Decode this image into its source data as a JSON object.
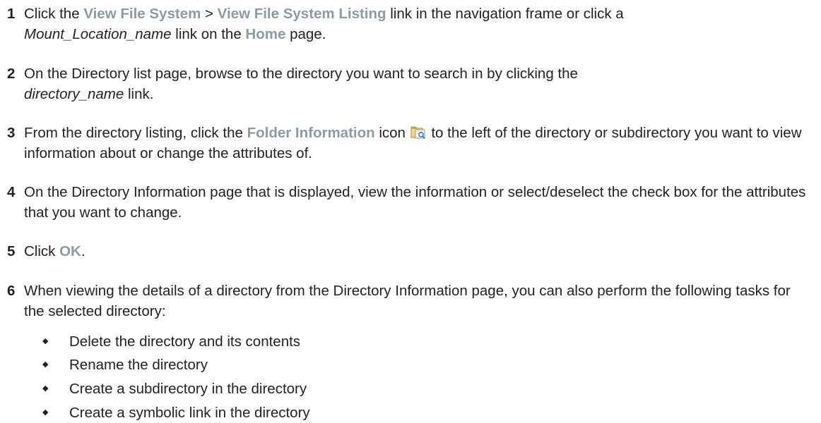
{
  "steps": [
    {
      "number": "1",
      "parts": [
        "Click the ",
        "View File System",
        " > ",
        "View File System Listing",
        " link in the navigation frame or click a ",
        "Mount_Location_name",
        " link on the ",
        "Home",
        " page."
      ]
    },
    {
      "number": "2",
      "parts": [
        "On the Directory list page, browse to the directory you want to search in by clicking the ",
        "directory_name",
        " link."
      ]
    },
    {
      "number": "3",
      "parts": [
        "From the directory listing, click the ",
        "Folder Information",
        " icon ",
        " to the left of the directory or subdirectory you want to view information about or change the attributes of."
      ],
      "icon": "folder-information-icon"
    },
    {
      "number": "4",
      "parts": [
        "On the Directory Information page that is displayed, view the information or select/deselect the check box for the attributes that you want to change."
      ]
    },
    {
      "number": "5",
      "parts": [
        "Click ",
        "OK",
        "."
      ]
    },
    {
      "number": "6",
      "parts": [
        "When viewing the details of a directory from the Directory Information page, you can also perform the following tasks for the selected directory:"
      ],
      "bullets": [
        "Delete the directory and its contents",
        "Rename the directory",
        "Create a subdirectory in the directory",
        "Create a symbolic link in the directory"
      ]
    }
  ],
  "bullet_glyph": "◆",
  "colors": {
    "ui_label": "#8a9aa6",
    "text": "#222222"
  }
}
